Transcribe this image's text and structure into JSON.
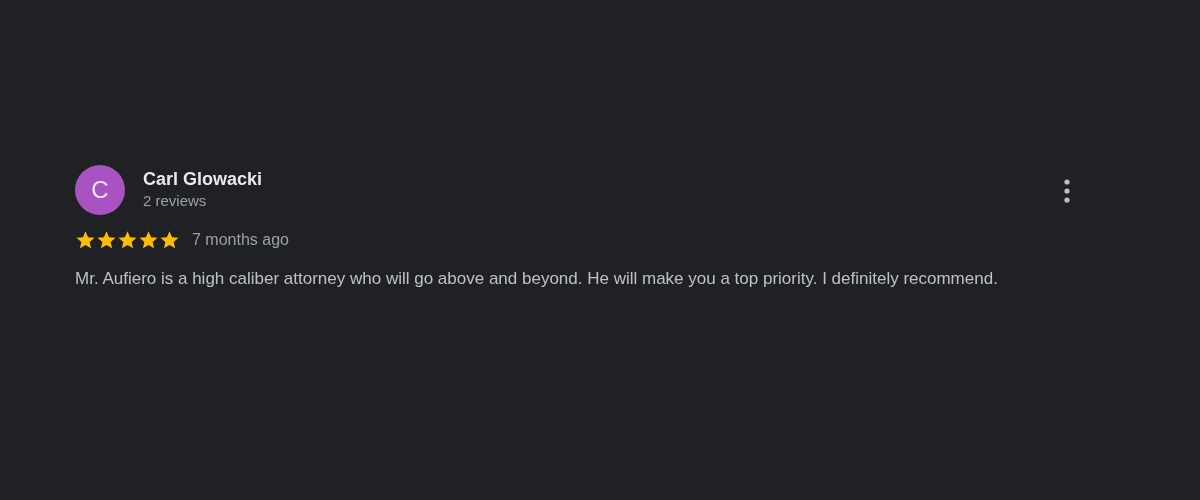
{
  "review": {
    "avatar_letter": "C",
    "author": "Carl Glowacki",
    "author_meta": "2 reviews",
    "stars": 5,
    "time": "7 months ago",
    "text": "Mr. Aufiero is a high caliber attorney who will go above and beyond. He will make you a top priority. I definitely recommend."
  }
}
